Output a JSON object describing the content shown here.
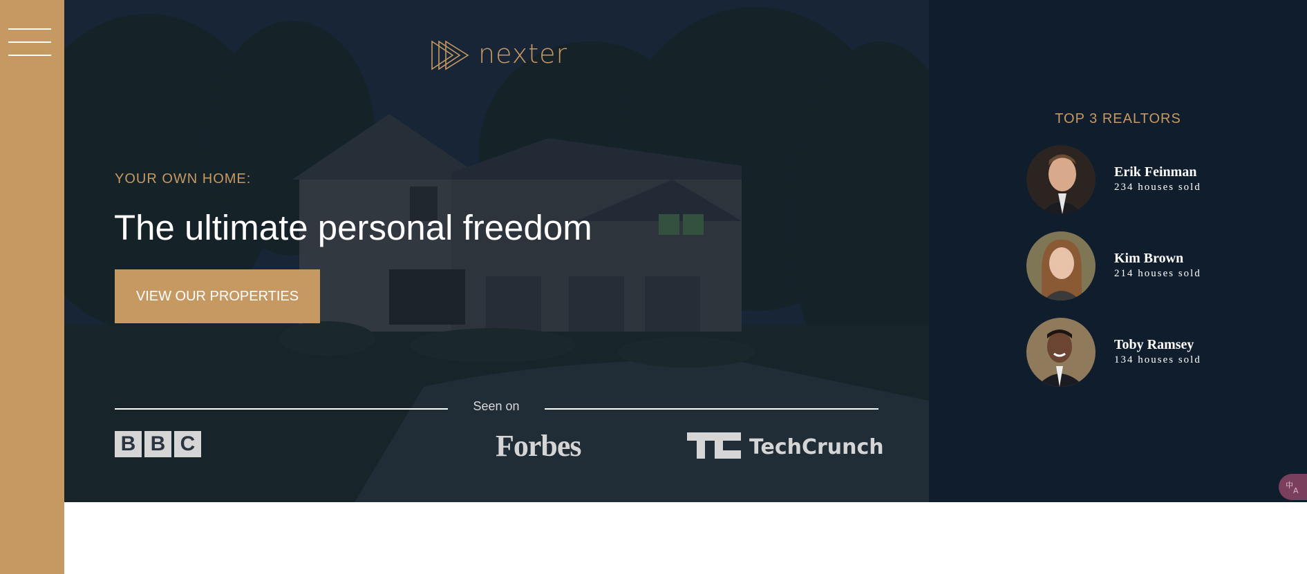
{
  "sidebar": {
    "menu_icon": "hamburger-menu-icon"
  },
  "header": {
    "logo_text": "nexter",
    "logo_icon": "triple-play-arrows-icon"
  },
  "hero": {
    "sub_heading": "YOUR OWN HOME:",
    "heading": "The ultimate personal freedom",
    "cta_label": "VIEW OUR PROPERTIES"
  },
  "seen_on": {
    "label": "Seen on",
    "logos": {
      "bbc_letters": [
        "B",
        "B",
        "C"
      ],
      "forbes": "Forbes",
      "techcrunch": "TechCrunch"
    }
  },
  "realtors": {
    "title": "TOP 3 REALTORS",
    "items": [
      {
        "name": "Erik Feinman",
        "sold": "234 houses sold"
      },
      {
        "name": "Kim Brown",
        "sold": "214 houses sold"
      },
      {
        "name": "Toby Ramsey",
        "sold": "134 houses sold"
      }
    ]
  },
  "colors": {
    "primary": "#c69963",
    "dark": "#101d2c",
    "white": "#ffffff"
  },
  "translate_widget": {
    "icon": "translate-icon"
  }
}
